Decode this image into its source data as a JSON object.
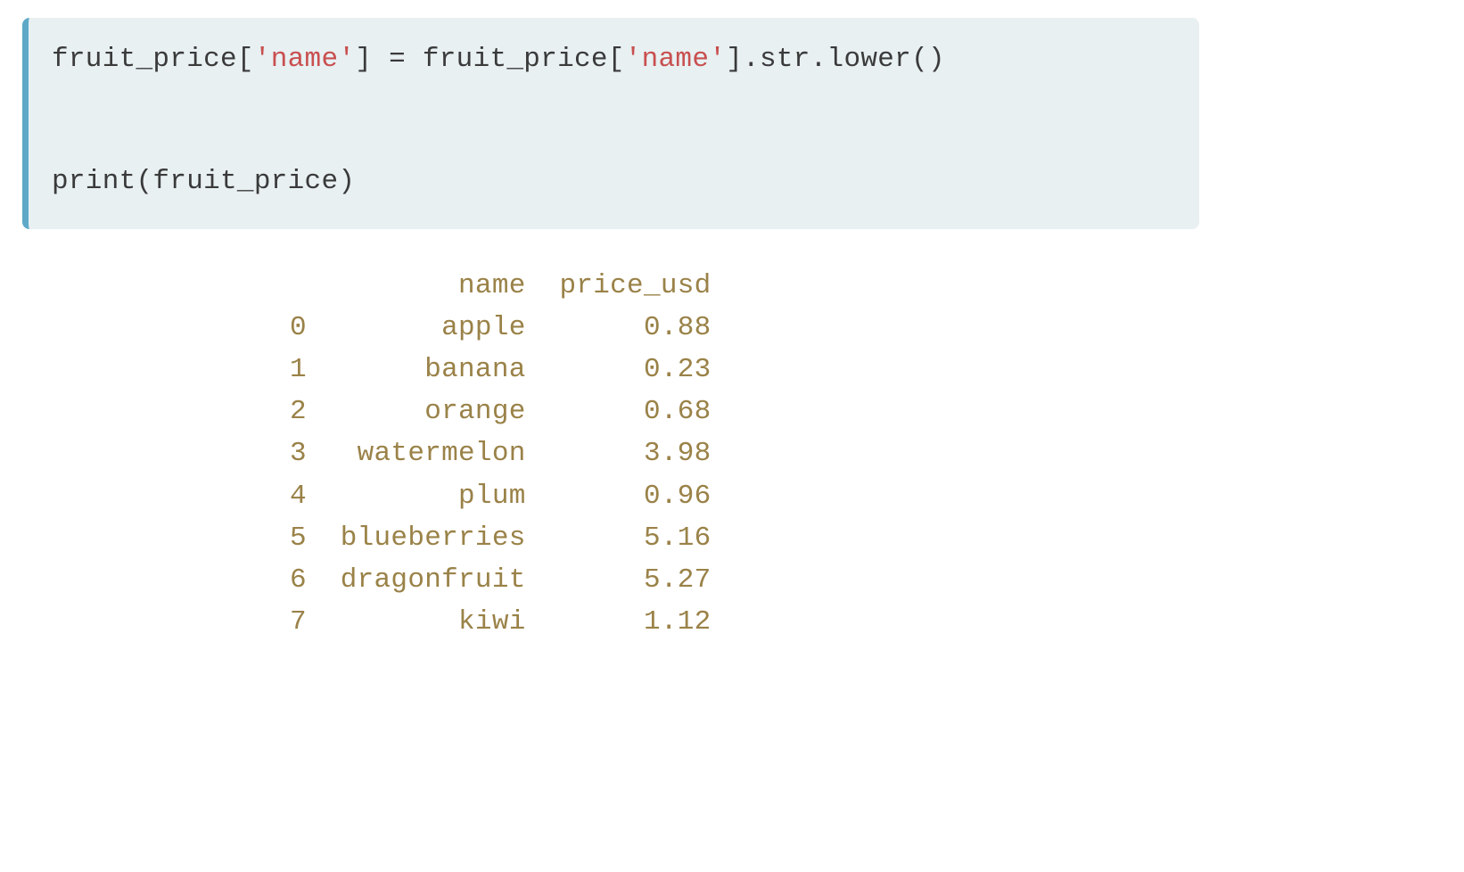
{
  "code": {
    "line1_parts": [
      "fruit_price[",
      "'name'",
      "] = fruit_price[",
      "'name'",
      "].str.lower()"
    ],
    "line2": "print(fruit_price)"
  },
  "output": {
    "header": {
      "col1": "name",
      "col2": "price_usd"
    },
    "rows": [
      {
        "index": "0",
        "name": "apple",
        "price": "0.88"
      },
      {
        "index": "1",
        "name": "banana",
        "price": "0.23"
      },
      {
        "index": "2",
        "name": "orange",
        "price": "0.68"
      },
      {
        "index": "3",
        "name": "watermelon",
        "price": "3.98"
      },
      {
        "index": "4",
        "name": "plum",
        "price": "0.96"
      },
      {
        "index": "5",
        "name": "blueberries",
        "price": "5.16"
      },
      {
        "index": "6",
        "name": "dragonfruit",
        "price": "5.27"
      },
      {
        "index": "7",
        "name": "kiwi",
        "price": "1.12"
      }
    ]
  }
}
